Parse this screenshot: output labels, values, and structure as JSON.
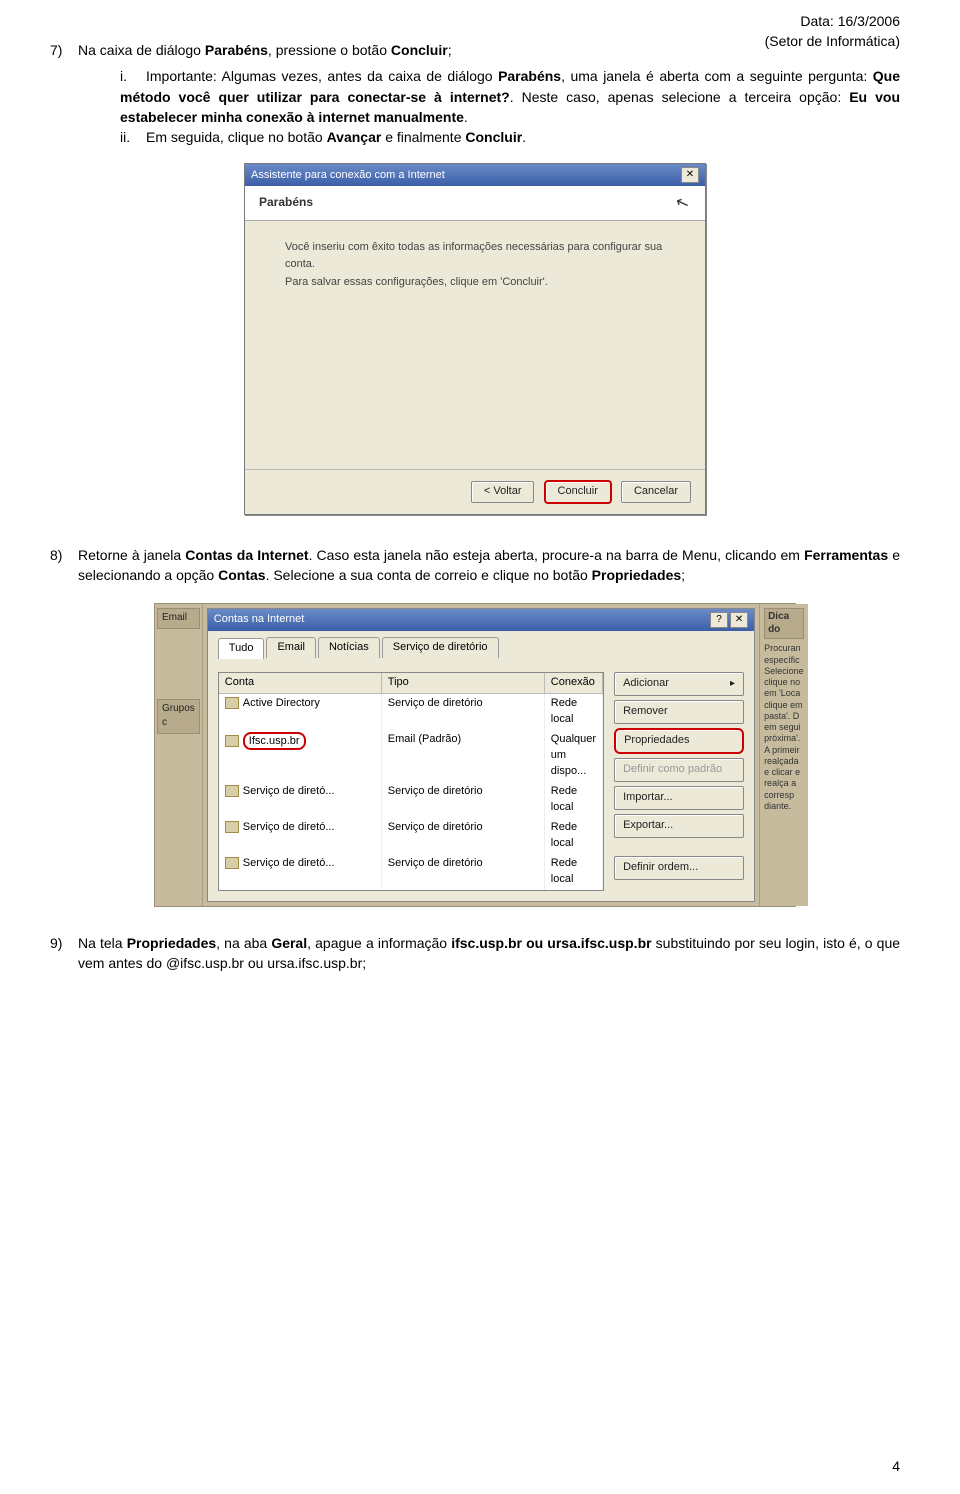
{
  "header": {
    "date_line": "Data: 16/3/2006",
    "sector_line": "(Setor de Informática)"
  },
  "step7": {
    "num": "7)",
    "pre": "Na caixa de diálogo ",
    "b1": "Parabéns",
    "mid": ", pressione o botão ",
    "b2": "Concluir",
    "post": ";"
  },
  "step7_i": {
    "roman": "i.",
    "t1": "Importante: Algumas vezes, antes da caixa de diálogo ",
    "b1": "Parabéns",
    "t2": ", uma janela é aberta com a seguinte pergunta: ",
    "b2": "Que método você quer utilizar para conectar-se à internet?",
    "t3": ". Neste caso, apenas selecione a terceira opção: ",
    "b3": "Eu vou estabelecer minha conexão à internet manualmente",
    "t4": "."
  },
  "step7_ii": {
    "roman": "ii.",
    "t1": "Em seguida, clique no botão ",
    "b1": "Avançar",
    "t2": " e finalmente ",
    "b2": "Concluir",
    "t3": "."
  },
  "wizard": {
    "title": "Assistente para conexão com a Internet",
    "head": "Parabéns",
    "line1": "Você inseriu com êxito todas as informações necessárias para configurar sua conta.",
    "line2": "Para salvar essas configurações, clique em 'Concluir'.",
    "btn_back": "< Voltar",
    "btn_finish": "Concluir",
    "btn_cancel": "Cancelar"
  },
  "step8": {
    "num": "8)",
    "t1": "Retorne à janela ",
    "b1": "Contas da Internet",
    "t2": ". Caso esta janela não esteja aberta, procure-a na barra de Menu, clicando em ",
    "b2": "Ferramentas",
    "t3": " e selecionando a opção ",
    "b3": "Contas",
    "t4": ". Selecione a sua conta de correio e clique no botão ",
    "b4": "Propriedades",
    "t5": ";"
  },
  "accounts": {
    "left_labels": {
      "email": "Email",
      "grupos": "Grupos c"
    },
    "title": "Contas na Internet",
    "tabs": {
      "tudo": "Tudo",
      "email": "Email",
      "noticias": "Notícias",
      "servico": "Serviço de diretório"
    },
    "cols": {
      "conta": "Conta",
      "tipo": "Tipo",
      "conexao": "Conexão"
    },
    "rows": [
      {
        "c": "Active Directory",
        "t": "Serviço de diretório",
        "x": "Rede local"
      },
      {
        "c": "Ifsc.usp.br",
        "t": "Email (Padrão)",
        "x": "Qualquer um dispo..."
      },
      {
        "c": "Serviço de diretó...",
        "t": "Serviço de diretório",
        "x": "Rede local"
      },
      {
        "c": "Serviço de diretó...",
        "t": "Serviço de diretório",
        "x": "Rede local"
      },
      {
        "c": "Serviço de diretó...",
        "t": "Serviço de diretório",
        "x": "Rede local"
      }
    ],
    "btns": {
      "add": "Adicionar",
      "remove": "Remover",
      "props": "Propriedades",
      "default": "Definir como padrão",
      "import": "Importar...",
      "export": "Exportar...",
      "order": "Definir ordem..."
    },
    "tip_head": "Dica do",
    "tip_body": "Procuran específic Selecione clique no em 'Loca clique em pasta'. D em segui próxima'. A primeir realçada e clicar e realça a corresp diante."
  },
  "step9": {
    "num": "9)",
    "t1": "Na tela ",
    "b1": "Propriedades",
    "t2": ", na aba ",
    "b2": "Geral",
    "t3": ", apague a informação ",
    "b3": "ifsc.usp.br ou ursa.ifsc.usp.br",
    "t4": " substituindo por seu login, isto é, o que vem antes do @ifsc.usp.br ou ursa.ifsc.usp.br;"
  },
  "page_number": "4"
}
